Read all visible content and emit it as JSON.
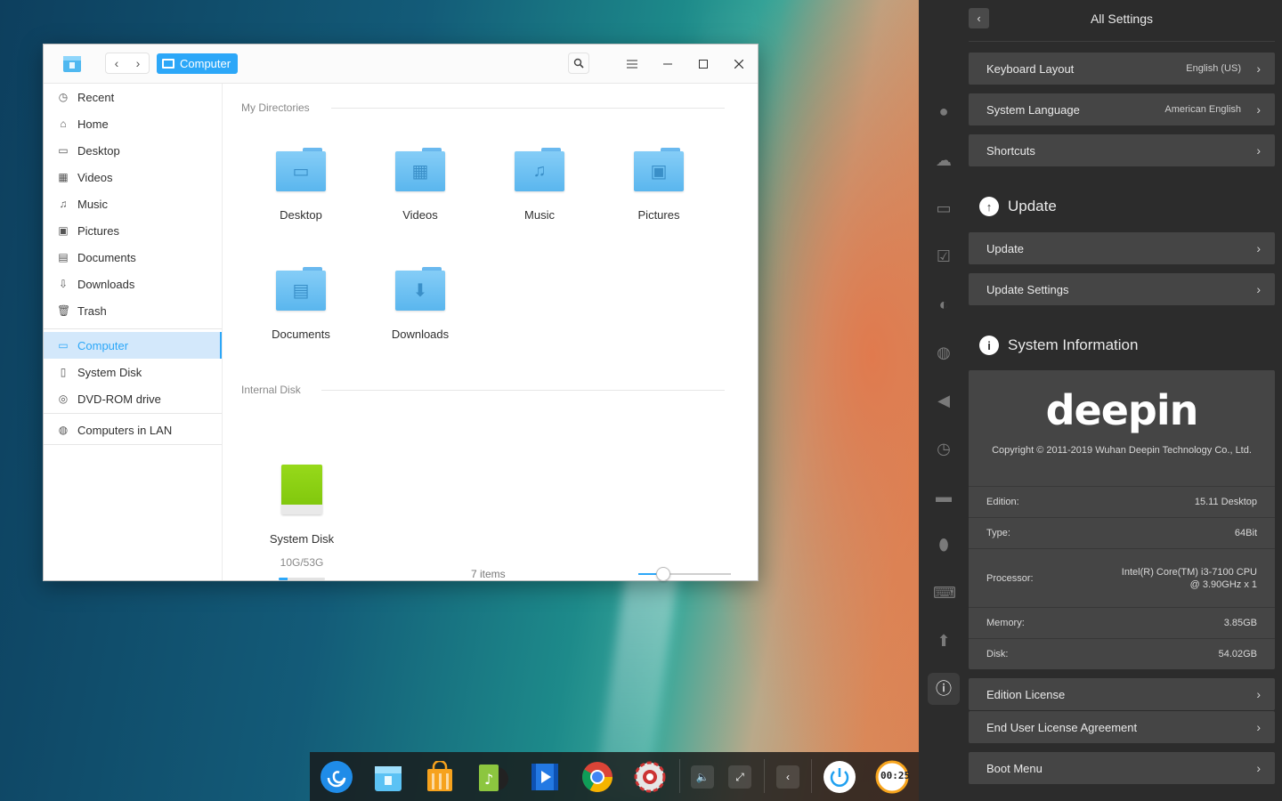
{
  "file_manager": {
    "breadcrumb": "Computer",
    "sidebar": {
      "items": [
        {
          "label": "Recent",
          "icon": "clock-icon"
        },
        {
          "label": "Home",
          "icon": "home-icon"
        },
        {
          "label": "Desktop",
          "icon": "desktop-icon"
        },
        {
          "label": "Videos",
          "icon": "videos-icon"
        },
        {
          "label": "Music",
          "icon": "music-icon"
        },
        {
          "label": "Pictures",
          "icon": "pictures-icon"
        },
        {
          "label": "Documents",
          "icon": "documents-icon"
        },
        {
          "label": "Downloads",
          "icon": "downloads-icon"
        },
        {
          "label": "Trash",
          "icon": "trash-icon"
        }
      ],
      "devices": [
        {
          "label": "Computer",
          "icon": "computer-icon",
          "active": true
        },
        {
          "label": "System Disk",
          "icon": "disk-icon"
        },
        {
          "label": "DVD-ROM drive",
          "icon": "dvd-icon"
        }
      ],
      "network": [
        {
          "label": "Computers in LAN",
          "icon": "network-icon"
        }
      ]
    },
    "main": {
      "my_directories_title": "My Directories",
      "folders": [
        "Desktop",
        "Videos",
        "Music",
        "Pictures",
        "Documents",
        "Downloads"
      ],
      "internal_disk_title": "Internal Disk",
      "disk": {
        "name": "System Disk",
        "size": "10G/53G",
        "used_fraction": 0.19
      },
      "status": "7 items",
      "zoom_fraction": 0.27
    },
    "accent_color": "#2ca7f8"
  },
  "settings": {
    "title": "All Settings",
    "rows_top": [
      {
        "label": "Keyboard Layout",
        "value": "English (US)"
      },
      {
        "label": "System Language",
        "value": "American English"
      },
      {
        "label": "Shortcuts",
        "value": ""
      }
    ],
    "update_heading": "Update",
    "update_rows": [
      "Update",
      "Update Settings"
    ],
    "sysinfo_heading": "System Information",
    "logo_text": "deepin",
    "copyright": "Copyright © 2011-2019 Wuhan Deepin Technology Co., Ltd.",
    "info": [
      {
        "label": "Edition:",
        "value": "15.11 Desktop"
      },
      {
        "label": "Type:",
        "value": "64Bit"
      },
      {
        "label": "Processor:",
        "value": "Intel(R) Core(TM) i3-7100 CPU",
        "value2": "@ 3.90GHz x 1"
      },
      {
        "label": "Memory:",
        "value": "3.85GB"
      },
      {
        "label": "Disk:",
        "value": "54.02GB"
      }
    ],
    "license_rows": [
      "Edition License",
      "End User License Agreement"
    ],
    "boot_row": "Boot Menu",
    "rail_icons": [
      "account-icon",
      "cloud-icon",
      "display-icon",
      "defaults-icon",
      "personalization-icon",
      "network-icon",
      "sound-icon",
      "time-icon",
      "power-icon",
      "mouse-icon",
      "keyboard-icon",
      "update-icon",
      "info-icon"
    ]
  },
  "dock": {
    "apps": [
      "launcher-icon",
      "file-manager-icon",
      "app-store-icon",
      "music-app-icon",
      "movie-app-icon",
      "chrome-icon",
      "settings-app-icon"
    ],
    "tray": [
      "volume-icon",
      "network-tray-icon",
      "collapse-icon",
      "power-button-icon",
      "clock-widget"
    ],
    "clock_text": "00:25"
  }
}
